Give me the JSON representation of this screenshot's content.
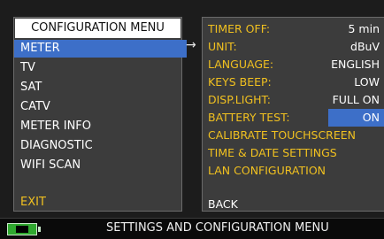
{
  "left_menu": {
    "title": "CONFIGURATION MENU",
    "items": [
      "METER",
      "TV",
      "SAT",
      "CATV",
      "METER INFO",
      "DIAGNOSTIC",
      "WIFI SCAN"
    ],
    "exit_label": "EXIT"
  },
  "arrow": "→",
  "settings": {
    "rows": [
      {
        "label": "TIMER OFF:",
        "value": "5 min"
      },
      {
        "label": "UNIT:",
        "value": "dBuV"
      },
      {
        "label": "LANGUAGE:",
        "value": "ENGLISH"
      },
      {
        "label": "KEYS BEEP:",
        "value": "LOW"
      },
      {
        "label": "DISP.LIGHT:",
        "value": "FULL ON"
      },
      {
        "label": "BATTERY TEST:",
        "value": "ON"
      }
    ],
    "actions": [
      "CALIBRATE TOUCHSCREEN",
      "TIME & DATE SETTINGS",
      "LAN CONFIGURATION"
    ],
    "back_label": "BACK"
  },
  "status_bar": {
    "text": "SETTINGS AND CONFIGURATION MENU"
  },
  "colors": {
    "accent": "#3d6fc8",
    "label_yellow": "#f0c020",
    "battery_green": "#2fa82f"
  }
}
